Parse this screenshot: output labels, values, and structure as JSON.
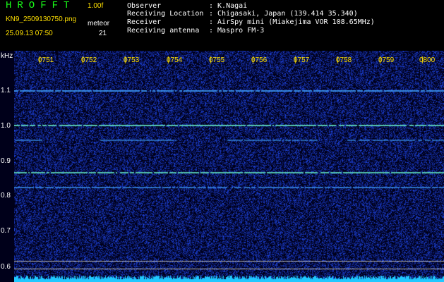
{
  "header": {
    "app_name": "HROFFT",
    "version": "1.00f",
    "filename": "KN9_2509130750.png",
    "datetime": "25.09.13 07:50",
    "meteor_label": "meteor",
    "meteor_count": "21",
    "info": [
      {
        "label": "Observer",
        "value": ": K.Nagai"
      },
      {
        "label": "Receiving Location",
        "value": ": Chigasaki, Japan (139.414 35.340)"
      },
      {
        "label": "Receiver",
        "value": ": AirSpy mini (Miakejima VOR 108.65MHz)"
      },
      {
        "label": "Receiving antenna",
        "value": ": Maspro FM-3"
      }
    ]
  },
  "plot": {
    "y_unit": "kHz",
    "y_ticks": [
      "1.1",
      "1.0",
      "0.9",
      "0.8",
      "0.7",
      "0.6"
    ],
    "time_labels": [
      "0751",
      "0752",
      "0753",
      "0754",
      "0755",
      "0756",
      "0757",
      "0758",
      "0759",
      "0800"
    ],
    "colors": {
      "background": "#00001a",
      "noise": "#1030c0",
      "carrier": "#40a0ff",
      "strong_carrier": "#60e0c0",
      "time_label": "#ffe000",
      "bottom_band": "#20c8ff"
    }
  }
}
